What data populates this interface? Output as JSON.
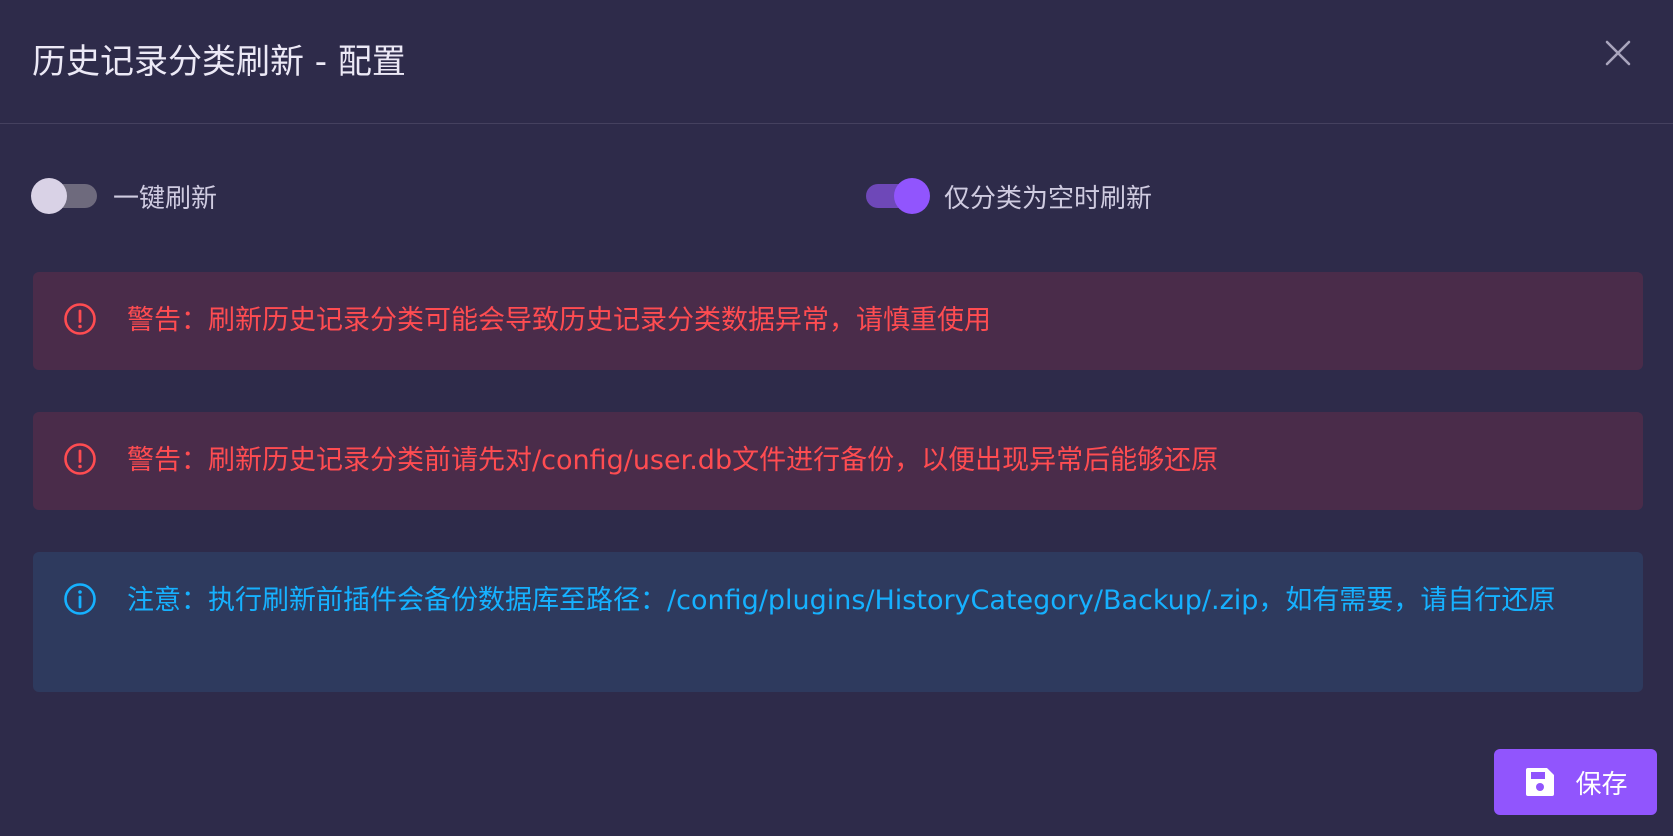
{
  "dialog": {
    "title": "历史记录分类刷新 - 配置",
    "close_icon": "close-icon"
  },
  "switches": [
    {
      "label": "一键刷新",
      "checked": false
    },
    {
      "label": "仅分类为空时刷新",
      "checked": true
    }
  ],
  "alerts": [
    {
      "type": "error",
      "icon": "alert-circle-icon",
      "text": "警告：刷新历史记录分类可能会导致历史记录分类数据异常，请慎重使用"
    },
    {
      "type": "error",
      "icon": "alert-circle-icon",
      "text": "警告：刷新历史记录分类前请先对/config/user.db文件进行备份，以便出现异常后能够还原"
    },
    {
      "type": "info",
      "icon": "info-circle-icon",
      "text": "注意：执行刷新前插件会备份数据库至路径：/config/plugins/HistoryCategory/Backup/.zip，如有需要，请自行还原"
    }
  ],
  "actions": {
    "save_label": "保存",
    "save_icon": "save-icon"
  },
  "colors": {
    "background": "#2e2b4a",
    "primary": "#9155fd",
    "error": "#ff4c51",
    "info": "#16b1ff"
  }
}
